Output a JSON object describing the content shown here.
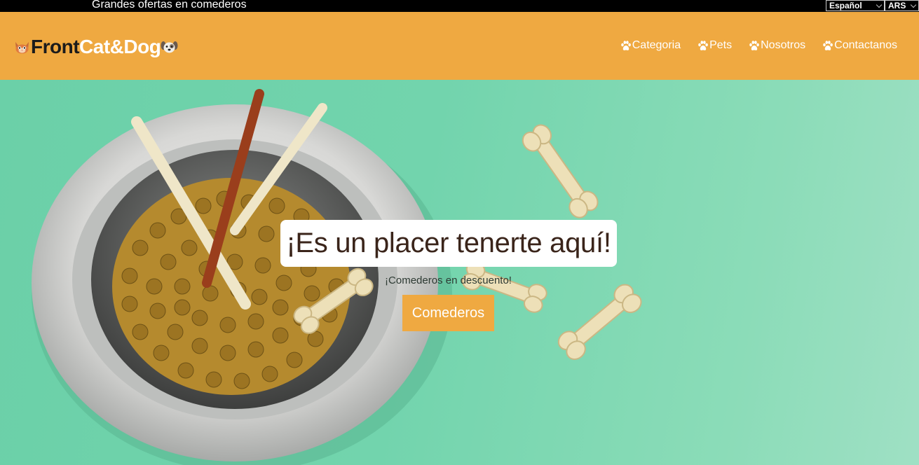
{
  "topbar": {
    "announcement": "Grandes ofertas en comederos",
    "language": {
      "selected": "Español"
    },
    "currency": {
      "selected": "ARS"
    }
  },
  "header": {
    "brand": {
      "part1": "Front",
      "part2": "Cat&Dog"
    },
    "nav": [
      {
        "label": "Categoria",
        "icon": "paw-icon"
      },
      {
        "label": "Pets",
        "icon": "paw-icon"
      },
      {
        "label": "Nosotros",
        "icon": "paw-icon"
      },
      {
        "label": "Contactanos",
        "icon": "paw-icon"
      }
    ]
  },
  "hero": {
    "title": "¡Es un placer tenerte aquí!",
    "subtitle": "¡Comederos en descuento!",
    "cta_label": "Comederos",
    "image_alt": "pet-food-bowl-with-chew-bones"
  },
  "colors": {
    "accent": "#efa941",
    "topbar": "#000000",
    "hero_bg": "#72d4ad",
    "title_text": "#3a241a"
  }
}
